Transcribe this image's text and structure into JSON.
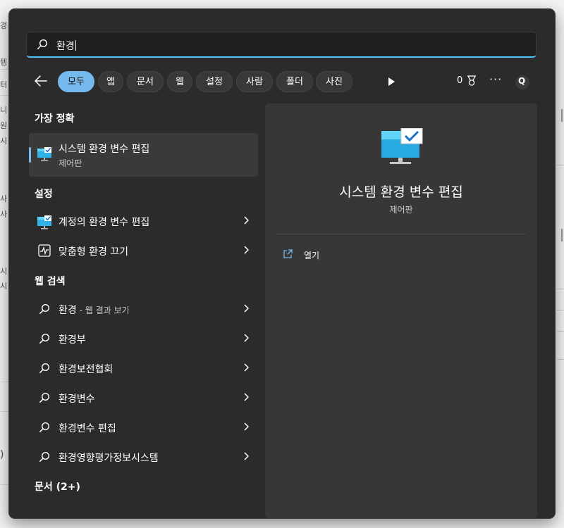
{
  "background": {
    "fragments": [
      "경",
      "템",
      "터",
      "니",
      "원",
      "시",
      "사",
      "사",
      "시",
      "시",
      ")"
    ]
  },
  "search": {
    "query": "환경"
  },
  "filters": {
    "chips": [
      "모두",
      "앱",
      "문서",
      "웹",
      "설정",
      "사람",
      "폴더",
      "사진"
    ],
    "active_index": 0,
    "points": "0",
    "bing_label": "Q"
  },
  "best_match": {
    "header": "가장 정확",
    "item": {
      "title": "시스템 환경 변수 편집",
      "subtitle": "제어판",
      "icon": "monitor-check-icon"
    }
  },
  "settings": {
    "header": "설정",
    "items": [
      {
        "label": "계정의 환경 변수 편집",
        "icon": "monitor-check-icon"
      },
      {
        "label": "맞춤형 환경 끄기",
        "icon": "activity-icon"
      }
    ]
  },
  "web": {
    "header": "웹 검색",
    "items": [
      {
        "label": "환경",
        "suffix": " - 웹 결과 보기"
      },
      {
        "label": "환경부",
        "suffix": ""
      },
      {
        "label": "환경보전협회",
        "suffix": ""
      },
      {
        "label": "환경변수",
        "suffix": ""
      },
      {
        "label": "환경변수 편집",
        "suffix": ""
      },
      {
        "label": "환경영향평가정보시스템",
        "suffix": ""
      }
    ]
  },
  "documents": {
    "header": "문서 (2+)"
  },
  "preview": {
    "title": "시스템 환경 변수 편집",
    "subtitle": "제어판",
    "actions": [
      {
        "label": "열기",
        "icon": "open-external-icon"
      }
    ]
  },
  "colors": {
    "accent": "#76b9ed",
    "search_underline": "#4cc2ff",
    "panel": "#2b2b2b",
    "preview": "#373737"
  }
}
